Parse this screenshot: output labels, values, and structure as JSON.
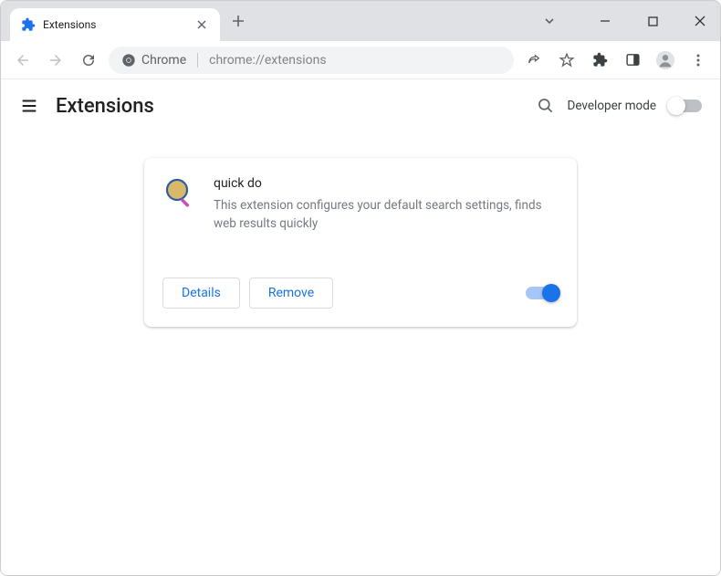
{
  "tab": {
    "title": "Extensions"
  },
  "omnibox": {
    "chip": "Chrome",
    "url": "chrome://extensions"
  },
  "page": {
    "title": "Extensions",
    "devmode_label": "Developer mode"
  },
  "extension": {
    "name": "quick do",
    "description": "This extension configures your default search settings, finds web results quickly",
    "details_label": "Details",
    "remove_label": "Remove"
  }
}
